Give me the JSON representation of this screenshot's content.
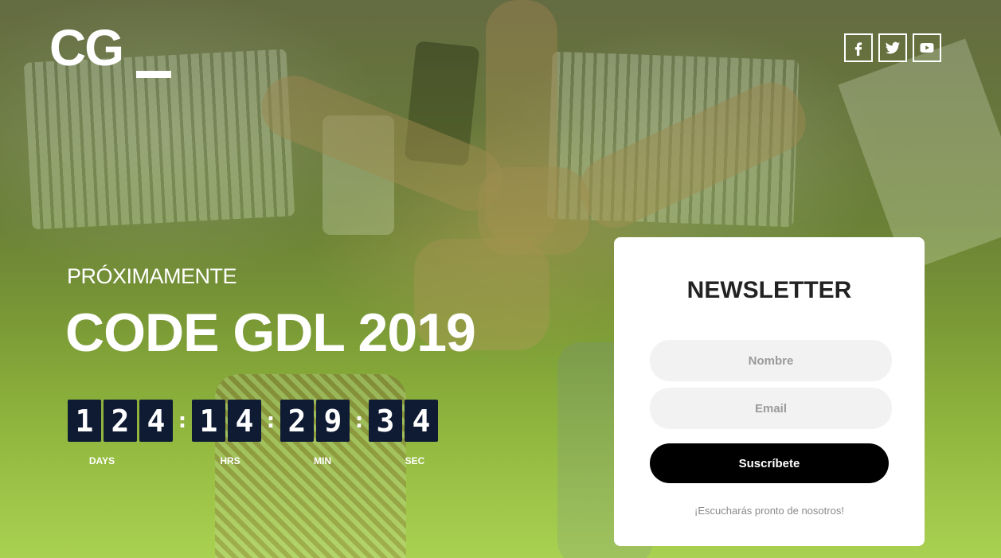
{
  "brand": {
    "logo_text": "CG"
  },
  "social": [
    {
      "name": "facebook-icon",
      "glyph": "f"
    },
    {
      "name": "twitter-icon",
      "glyph": "t"
    },
    {
      "name": "youtube-icon",
      "glyph": "yt"
    }
  ],
  "hero": {
    "subtitle": "PRÓXIMAMENTE",
    "title": "CODE GDL 2019"
  },
  "countdown": {
    "days": [
      "1",
      "2",
      "4"
    ],
    "hrs": [
      "1",
      "4"
    ],
    "min": [
      "2",
      "9"
    ],
    "sec": [
      "3",
      "4"
    ],
    "separator": ":",
    "labels": {
      "days": "DAYS",
      "hrs": "HRS",
      "min": "MIN",
      "sec": "SEC"
    }
  },
  "newsletter": {
    "title": "NEWSLETTER",
    "name_placeholder": "Nombre",
    "email_placeholder": "Email",
    "submit_label": "Suscríbete",
    "note": "¡Escucharás pronto de nosotros!"
  },
  "colors": {
    "digit_bg": "#0f1a33",
    "button_bg": "#000000",
    "card_bg": "#ffffff",
    "overlay_green": "#a9cf52"
  }
}
